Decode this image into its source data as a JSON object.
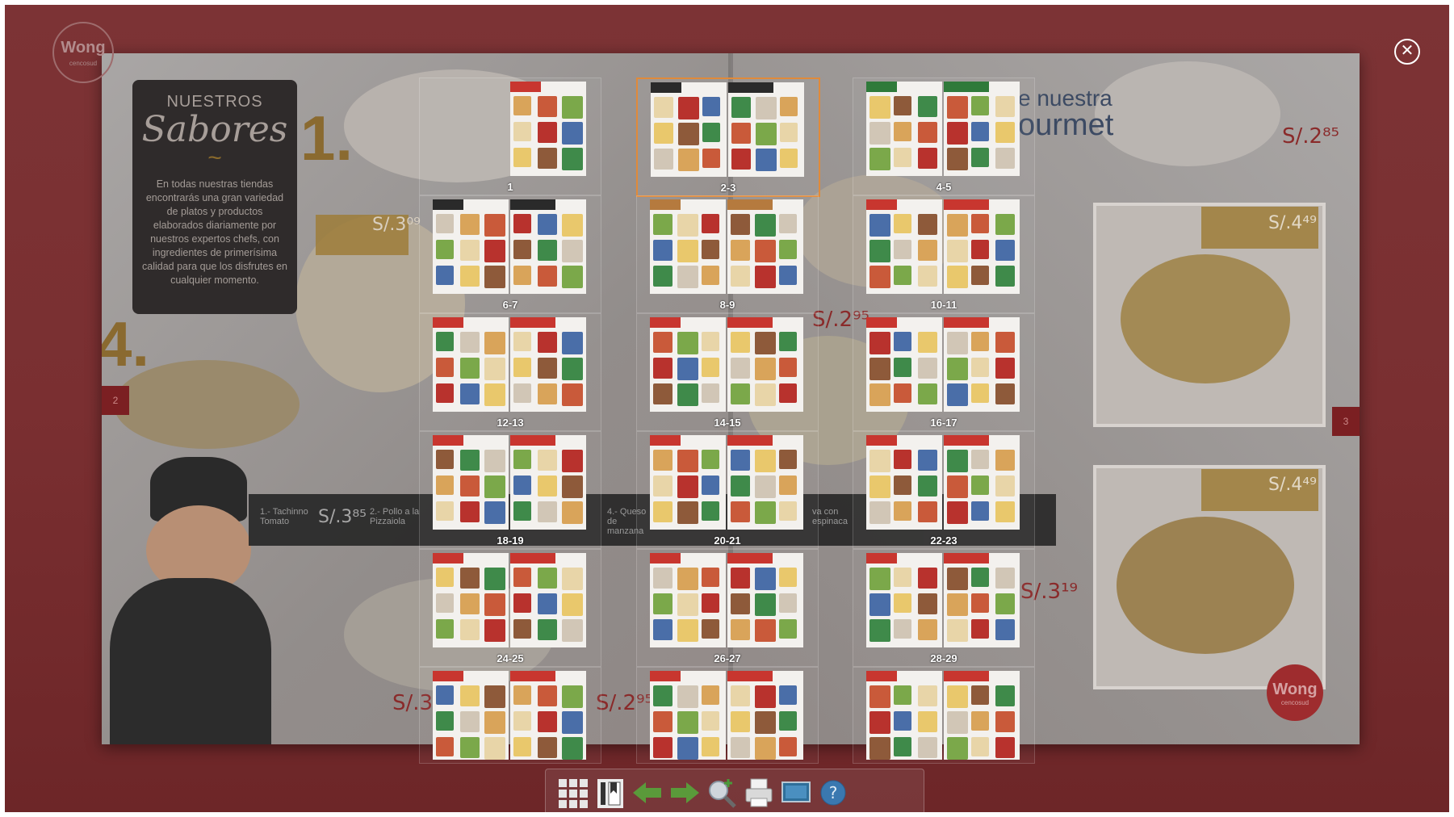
{
  "viewer": {
    "close_glyph": "✕",
    "toolbar": {
      "buttons": [
        {
          "name": "thumbnails-grid-button",
          "icon": "grid-icon"
        },
        {
          "name": "table-of-contents-button",
          "icon": "book-icon"
        },
        {
          "name": "previous-page-button",
          "icon": "arrow-left-icon"
        },
        {
          "name": "next-page-button",
          "icon": "arrow-right-icon"
        },
        {
          "name": "zoom-in-button",
          "icon": "magnifier-plus-icon"
        },
        {
          "name": "print-button",
          "icon": "printer-icon"
        },
        {
          "name": "fullscreen-button",
          "icon": "monitor-icon"
        },
        {
          "name": "help-button",
          "icon": "question-icon"
        }
      ]
    }
  },
  "background_spread": {
    "logo_top_left": {
      "word": "Wong",
      "sub": "cencosud"
    },
    "logo_bottom_right": {
      "word": "Wong",
      "sub": "cencosud"
    },
    "sabores_box": {
      "line1": "NUESTROS",
      "line2": "Sabores",
      "body": "En todas nuestras tiendas encontrarás una gran variedad de platos y productos elaborados diariamente por nuestros expertos chefs, con ingredientes de primerísima calidad para que los disfrutes en cualquier momento."
    },
    "numbers": [
      "1.",
      "4."
    ],
    "side_tabs": [
      "2",
      "3"
    ],
    "heading_fragments": [
      "e nuestra",
      "ourmet"
    ],
    "prices": [
      "S/.2⁸⁵",
      "S/.3⁰⁹",
      "S/.4⁴⁹",
      "S/.2⁹⁵",
      "S/.4⁴⁹",
      "S/.3⁸⁵",
      "S/.3¹⁹",
      "S/.3⁰⁵",
      "S/.2⁹⁵"
    ],
    "strip_items": [
      "1.- Tachinno Tomato",
      "2.- Pollo a la Pizzaiola",
      "4.- Queso de manzana",
      "va con espinaca"
    ]
  },
  "thumbnails": [
    {
      "label": "1",
      "selected": false,
      "single": true,
      "accent": "#c8362f"
    },
    {
      "label": "2-3",
      "selected": true,
      "single": false,
      "accent": "#2a2a2a"
    },
    {
      "label": "4-5",
      "selected": false,
      "single": false,
      "accent": "#2f7a3a"
    },
    {
      "label": "6-7",
      "selected": false,
      "single": false,
      "accent": "#2a2a2a"
    },
    {
      "label": "8-9",
      "selected": false,
      "single": false,
      "accent": "#b57a3e"
    },
    {
      "label": "10-11",
      "selected": false,
      "single": false,
      "accent": "#c8362f"
    },
    {
      "label": "12-13",
      "selected": false,
      "single": false,
      "accent": "#c8362f"
    },
    {
      "label": "14-15",
      "selected": false,
      "single": false,
      "accent": "#c8362f"
    },
    {
      "label": "16-17",
      "selected": false,
      "single": false,
      "accent": "#c8362f"
    },
    {
      "label": "18-19",
      "selected": false,
      "single": false,
      "accent": "#c8362f"
    },
    {
      "label": "20-21",
      "selected": false,
      "single": false,
      "accent": "#c8362f"
    },
    {
      "label": "22-23",
      "selected": false,
      "single": false,
      "accent": "#c8362f"
    },
    {
      "label": "24-25",
      "selected": false,
      "single": false,
      "accent": "#c8362f"
    },
    {
      "label": "26-27",
      "selected": false,
      "single": false,
      "accent": "#c8362f"
    },
    {
      "label": "28-29",
      "selected": false,
      "single": false,
      "accent": "#c8362f"
    },
    {
      "label": "",
      "selected": false,
      "single": false,
      "accent": "#c8362f"
    },
    {
      "label": "",
      "selected": false,
      "single": false,
      "accent": "#c8362f"
    },
    {
      "label": "",
      "selected": false,
      "single": false,
      "accent": "#c8362f"
    }
  ],
  "colors": {
    "backdrop": "#7a2f31",
    "selection": "#e08a3a",
    "toolbar_icon": "#e8e8e8",
    "arrow_icon": "#5a9a3a",
    "help_icon": "#3a78b0"
  }
}
